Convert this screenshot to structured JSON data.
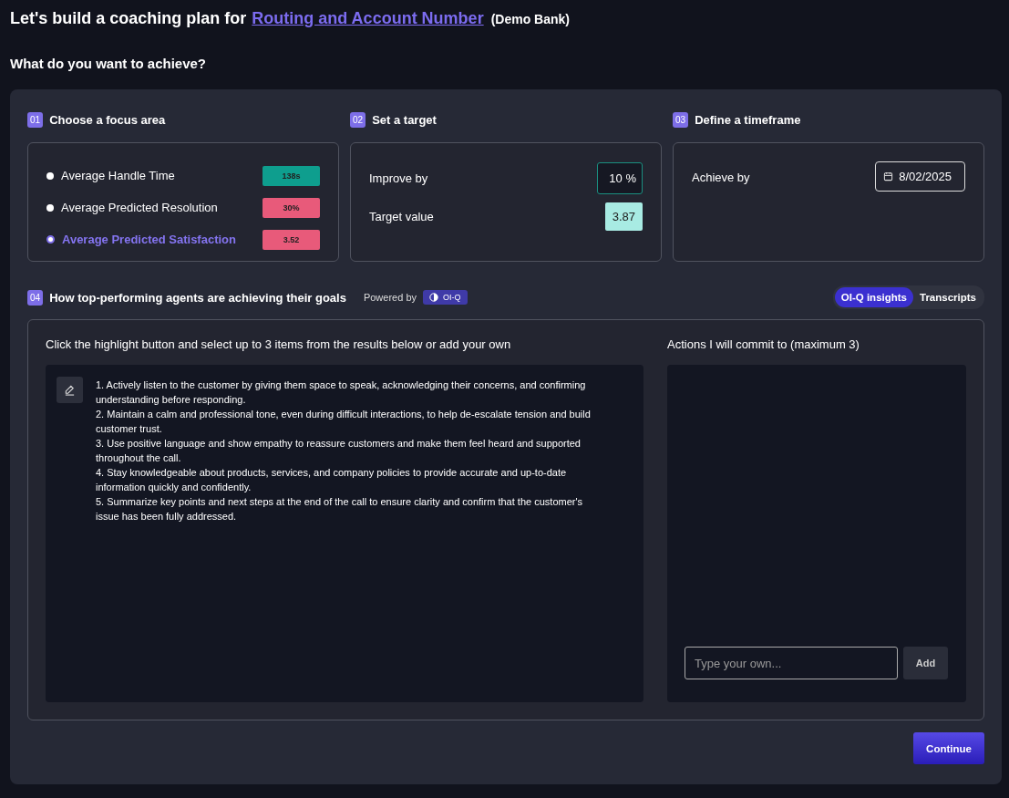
{
  "heading": {
    "prefix": "Let's build a coaching plan for",
    "link": "Routing and Account Number",
    "suffix": "(Demo Bank)"
  },
  "question": "What do you want to achieve?",
  "steps": [
    {
      "number": "01",
      "title": "Choose a focus area"
    },
    {
      "number": "02",
      "title": "Set a target"
    },
    {
      "number": "03",
      "title": "Define a timeframe"
    }
  ],
  "focus_areas": [
    {
      "label": "Average Handle Time",
      "value": "138s",
      "color": "#0e9e8e",
      "selected": false
    },
    {
      "label": "Average Predicted Resolution",
      "value": "30%",
      "color": "#e85a7a",
      "selected": false
    },
    {
      "label": "Average Predicted Satisfaction",
      "value": "3.52",
      "color": "#e85a7a",
      "selected": true
    }
  ],
  "target": {
    "improve_label": "Improve by",
    "improve_value": "10 %",
    "target_label": "Target value",
    "target_value": "3.87"
  },
  "timeframe": {
    "label": "Achieve by",
    "date": "8/02/2025"
  },
  "insights": {
    "number": "04",
    "title": "How top-performing agents are achieving their goals",
    "powered_by": "Powered by",
    "brand": "OI-Q",
    "tabs": [
      {
        "label": "OI-Q insights",
        "selected": true
      },
      {
        "label": "Transcripts",
        "selected": false
      }
    ],
    "instructions": "Click the highlight button and select up to 3 items from the results below or add your own",
    "results": [
      "1. Actively listen to the customer by giving them space to speak, acknowledging their concerns, and confirming understanding before responding.",
      "2. Maintain a calm and professional tone, even during difficult interactions, to help de-escalate tension and build customer trust.",
      "3. Use positive language and show empathy to reassure customers and make them feel heard and supported throughout the call.",
      "4. Stay knowledgeable about products, services, and company policies to provide accurate and up-to-date information quickly and confidently.",
      "5. Summarize key points and next steps at the end of the call to ensure clarity and confirm that the customer's issue has been fully addressed."
    ],
    "actions_title": "Actions I will commit to (maximum 3)",
    "own_field": {
      "placeholder": "Type your own..."
    },
    "add_button": "Add"
  },
  "continue_button": "Continue"
}
